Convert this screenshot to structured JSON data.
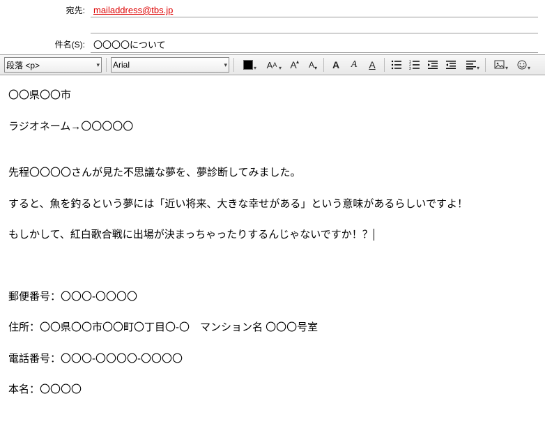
{
  "header": {
    "to_label": "宛先:",
    "to_value": "mailaddress@tbs.jp",
    "subject_label": "件名(S):",
    "subject_value": "〇〇〇〇について"
  },
  "toolbar": {
    "paragraph_label": "段落 <p>",
    "font_label": "Arial",
    "font_size_hint": "AA",
    "increase_font": "A",
    "decrease_font": "A",
    "bold": "A",
    "italic": "A",
    "underline": "A",
    "align_menu": "≡"
  },
  "body": {
    "line1": "〇〇県〇〇市",
    "line2": "ラジオネーム→〇〇〇〇〇",
    "line3": "先程〇〇〇〇さんが見た不思議な夢を、夢診断してみました。",
    "line4": "すると、魚を釣るという夢には「近い将来、大きな幸せがある」という意味があるらしいですよ！",
    "line5": "もしかして、紅白歌合戦に出場が決まっちゃったりするんじゃないですか！？",
    "postal": "郵便番号：〇〇〇-〇〇〇〇",
    "address": "住所：〇〇県〇〇市〇〇町〇丁目〇-〇　マンション名 〇〇〇号室",
    "phone": "電話番号：〇〇〇-〇〇〇〇-〇〇〇〇",
    "realname": "本名：〇〇〇〇"
  }
}
